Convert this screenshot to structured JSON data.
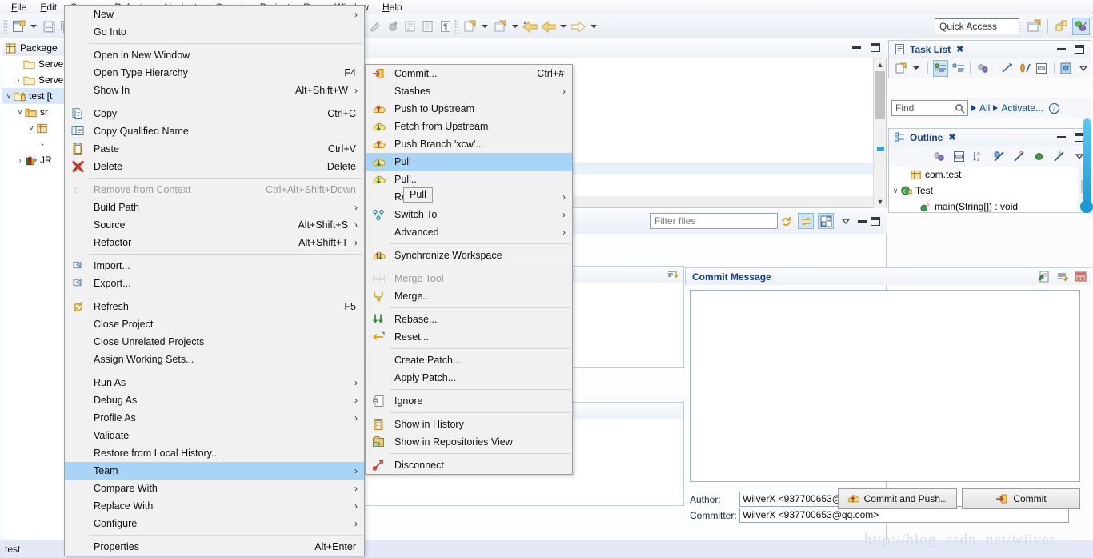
{
  "menubar": {
    "items": [
      "File",
      "Edit",
      "Source",
      "Refactor",
      "Navigate",
      "Search",
      "Project",
      "Run",
      "Window",
      "Help"
    ]
  },
  "toolbar": {
    "quick_access_placeholder": "Quick Access"
  },
  "package_explorer": {
    "tab_label": "Package",
    "tree": [
      {
        "label": "Serve",
        "arrow": "",
        "icon": "folder-icon",
        "indent": 14,
        "selected": false
      },
      {
        "label": "Serve",
        "arrow": "›",
        "icon": "folder-icon",
        "indent": 14,
        "selected": false
      },
      {
        "label": "test [t",
        "arrow": "∨",
        "icon": "project-icon",
        "indent": 2,
        "selected": true
      },
      {
        "label": "sr",
        "arrow": "∨",
        "icon": "src-icon",
        "indent": 16,
        "selected": false
      },
      {
        "label": "",
        "arrow": "∨",
        "icon": "package-icon",
        "indent": 30,
        "selected": false
      },
      {
        "label": "",
        "arrow": "›",
        "icon": "",
        "indent": 44,
        "selected": false
      },
      {
        "label": "JR",
        "arrow": "›",
        "icon": "jre-icon",
        "indent": 16,
        "selected": false
      }
    ]
  },
  "status_bar": {
    "text": "test"
  },
  "context_menu": {
    "items": [
      {
        "label": "New",
        "accel": "",
        "submenu": true,
        "icon": "",
        "disabled": false
      },
      {
        "label": "Go Into",
        "accel": "",
        "submenu": false,
        "icon": "",
        "disabled": false
      },
      {
        "separator": true
      },
      {
        "label": "Open in New Window",
        "accel": "",
        "submenu": false,
        "icon": "",
        "disabled": false
      },
      {
        "label": "Open Type Hierarchy",
        "accel": "F4",
        "submenu": false,
        "icon": "",
        "disabled": false
      },
      {
        "label": "Show In",
        "accel": "Alt+Shift+W",
        "submenu": true,
        "icon": "",
        "disabled": false
      },
      {
        "separator": true
      },
      {
        "label": "Copy",
        "accel": "Ctrl+C",
        "submenu": false,
        "icon": "copy-icon",
        "disabled": false
      },
      {
        "label": "Copy Qualified Name",
        "accel": "",
        "submenu": false,
        "icon": "copy-qualified-icon",
        "disabled": false
      },
      {
        "label": "Paste",
        "accel": "Ctrl+V",
        "submenu": false,
        "icon": "paste-icon",
        "disabled": false
      },
      {
        "label": "Delete",
        "accel": "Delete",
        "submenu": false,
        "icon": "delete-icon",
        "disabled": false
      },
      {
        "separator": true
      },
      {
        "label": "Remove from Context",
        "accel": "Ctrl+Alt+Shift+Down",
        "submenu": false,
        "icon": "remove-context-icon",
        "disabled": true
      },
      {
        "label": "Build Path",
        "accel": "",
        "submenu": true,
        "icon": "",
        "disabled": false
      },
      {
        "label": "Source",
        "accel": "Alt+Shift+S",
        "submenu": true,
        "icon": "",
        "disabled": false
      },
      {
        "label": "Refactor",
        "accel": "Alt+Shift+T",
        "submenu": true,
        "icon": "",
        "disabled": false
      },
      {
        "separator": true
      },
      {
        "label": "Import...",
        "accel": "",
        "submenu": false,
        "icon": "import-icon",
        "disabled": false
      },
      {
        "label": "Export...",
        "accel": "",
        "submenu": false,
        "icon": "export-icon",
        "disabled": false
      },
      {
        "separator": true
      },
      {
        "label": "Refresh",
        "accel": "F5",
        "submenu": false,
        "icon": "refresh-icon",
        "disabled": false
      },
      {
        "label": "Close Project",
        "accel": "",
        "submenu": false,
        "icon": "",
        "disabled": false
      },
      {
        "label": "Close Unrelated Projects",
        "accel": "",
        "submenu": false,
        "icon": "",
        "disabled": false
      },
      {
        "label": "Assign Working Sets...",
        "accel": "",
        "submenu": false,
        "icon": "",
        "disabled": false
      },
      {
        "separator": true
      },
      {
        "label": "Run As",
        "accel": "",
        "submenu": true,
        "icon": "",
        "disabled": false
      },
      {
        "label": "Debug As",
        "accel": "",
        "submenu": true,
        "icon": "",
        "disabled": false
      },
      {
        "label": "Profile As",
        "accel": "",
        "submenu": true,
        "icon": "",
        "disabled": false
      },
      {
        "label": "Validate",
        "accel": "",
        "submenu": false,
        "icon": "",
        "disabled": false
      },
      {
        "label": "Restore from Local History...",
        "accel": "",
        "submenu": false,
        "icon": "",
        "disabled": false
      },
      {
        "label": "Team",
        "accel": "",
        "submenu": true,
        "icon": "",
        "disabled": false,
        "selected": true
      },
      {
        "label": "Compare With",
        "accel": "",
        "submenu": true,
        "icon": "",
        "disabled": false
      },
      {
        "label": "Replace With",
        "accel": "",
        "submenu": true,
        "icon": "",
        "disabled": false
      },
      {
        "label": "Configure",
        "accel": "",
        "submenu": true,
        "icon": "",
        "disabled": false
      },
      {
        "separator": true
      },
      {
        "label": "Properties",
        "accel": "Alt+Enter",
        "submenu": false,
        "icon": "",
        "disabled": false
      }
    ]
  },
  "team_submenu": {
    "items": [
      {
        "label": "Commit...",
        "accel": "Ctrl+#",
        "submenu": false,
        "icon": "commit-icon",
        "disabled": false
      },
      {
        "label": "Stashes",
        "accel": "",
        "submenu": true,
        "icon": "",
        "disabled": false
      },
      {
        "label": "Push to Upstream",
        "accel": "",
        "submenu": false,
        "icon": "push-icon",
        "disabled": false
      },
      {
        "label": "Fetch from Upstream",
        "accel": "",
        "submenu": false,
        "icon": "fetch-icon",
        "disabled": false
      },
      {
        "label": "Push Branch 'xcw'...",
        "accel": "",
        "submenu": false,
        "icon": "push-icon",
        "disabled": false
      },
      {
        "label": "Pull",
        "accel": "",
        "submenu": false,
        "icon": "pull-icon",
        "disabled": false,
        "selected": true
      },
      {
        "label": "Pull...",
        "accel": "",
        "submenu": false,
        "icon": "pull-icon",
        "disabled": false
      },
      {
        "label": "Remote",
        "accel": "",
        "submenu": true,
        "icon": "",
        "disabled": false
      },
      {
        "label": "Switch To",
        "accel": "",
        "submenu": true,
        "icon": "switch-icon",
        "disabled": false
      },
      {
        "label": "Advanced",
        "accel": "",
        "submenu": true,
        "icon": "",
        "disabled": false
      },
      {
        "separator": true
      },
      {
        "label": "Synchronize Workspace",
        "accel": "",
        "submenu": false,
        "icon": "sync-icon",
        "disabled": false
      },
      {
        "separator": true
      },
      {
        "label": "Merge Tool",
        "accel": "",
        "submenu": false,
        "icon": "merge-tool-icon",
        "disabled": true
      },
      {
        "label": "Merge...",
        "accel": "",
        "submenu": false,
        "icon": "merge-icon",
        "disabled": false
      },
      {
        "separator": true
      },
      {
        "label": "Rebase...",
        "accel": "",
        "submenu": false,
        "icon": "rebase-icon",
        "disabled": false
      },
      {
        "label": "Reset...",
        "accel": "",
        "submenu": false,
        "icon": "reset-icon",
        "disabled": false
      },
      {
        "separator": true
      },
      {
        "label": "Create Patch...",
        "accel": "",
        "submenu": false,
        "icon": "",
        "disabled": false
      },
      {
        "label": "Apply Patch...",
        "accel": "",
        "submenu": false,
        "icon": "",
        "disabled": false
      },
      {
        "separator": true
      },
      {
        "label": "Ignore",
        "accel": "",
        "submenu": false,
        "icon": "ignore-icon",
        "disabled": false
      },
      {
        "separator": true
      },
      {
        "label": "Show in History",
        "accel": "",
        "submenu": false,
        "icon": "history-icon",
        "disabled": false
      },
      {
        "label": "Show in Repositories View",
        "accel": "",
        "submenu": false,
        "icon": "repo-icon",
        "disabled": false
      },
      {
        "separator": true
      },
      {
        "label": "Disconnect",
        "accel": "",
        "submenu": false,
        "icon": "disconnect-icon",
        "disabled": false
      }
    ]
  },
  "tooltip": {
    "text": "Pull"
  },
  "task_list": {
    "title": "Task List",
    "close_glyph": "✖",
    "find_placeholder": "Find",
    "all_label": "All",
    "activate_label": "Activate..."
  },
  "outline": {
    "title": "Outline",
    "close_glyph": "✖",
    "items": [
      {
        "label": "com.test",
        "icon": "package-icon",
        "arrow": "",
        "indent": 14
      },
      {
        "label": "Test",
        "icon": "class-icon",
        "arrow": "∨",
        "indent": 2
      },
      {
        "label": "main(String[]) : void",
        "icon": "method-icon",
        "arrow": "",
        "indent": 26
      }
    ]
  },
  "staging": {
    "filter_placeholder": "Filter files"
  },
  "commit_panel": {
    "title": "Commit Message",
    "message_value": "",
    "author_label": "Author:",
    "author_value": "WilverX <937700653@qq.com>",
    "committer_label": "Committer:",
    "committer_value": "WilverX <937700653@qq.com>",
    "commit_push_label": "Commit and Push...",
    "commit_label": "Commit"
  },
  "watermark": {
    "text": "http://blog. csdn. net/wilver"
  },
  "colors": {
    "menu_highlight": "#a8d4f7",
    "tree_selection": "#d6e8f9",
    "panel_title": "#15428b",
    "accent_blue": "#0b4fa0"
  }
}
